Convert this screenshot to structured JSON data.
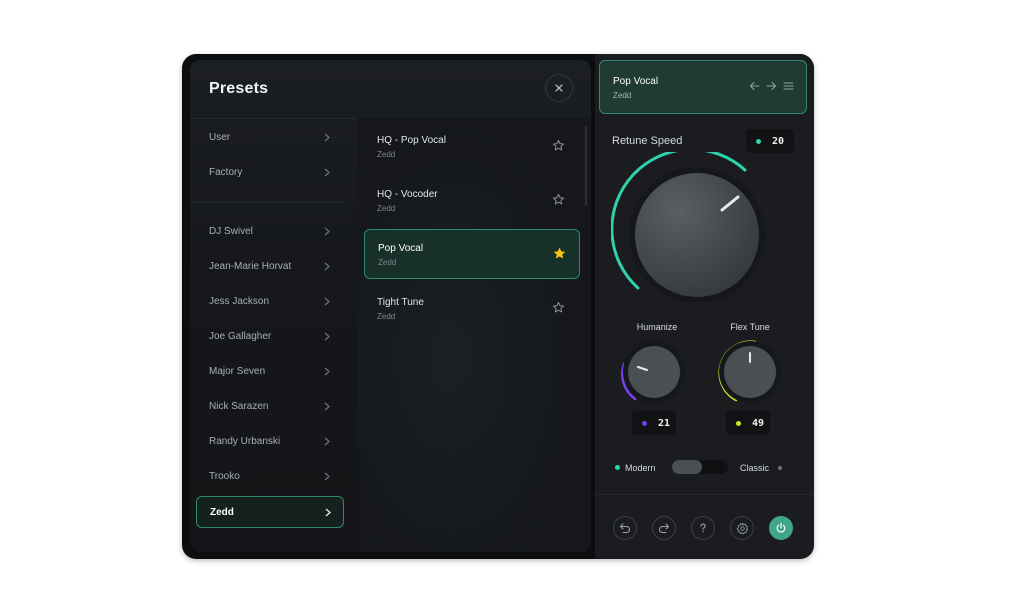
{
  "presets": {
    "title": "Presets",
    "categories": [
      {
        "label": "User"
      },
      {
        "label": "Factory"
      }
    ],
    "artists": [
      {
        "label": "DJ Swivel"
      },
      {
        "label": "Jean-Marie Horvat"
      },
      {
        "label": "Jess Jackson"
      },
      {
        "label": "Joe Gallagher"
      },
      {
        "label": "Major Seven"
      },
      {
        "label": "Nick Sarazen"
      },
      {
        "label": "Randy  Urbanski"
      },
      {
        "label": "Trooko"
      },
      {
        "label": "Zedd",
        "selected": true
      }
    ],
    "items": [
      {
        "name": "HQ - Pop Vocal",
        "author": "Zedd",
        "starred": false
      },
      {
        "name": "HQ - Vocoder",
        "author": "Zedd",
        "starred": false
      },
      {
        "name": "Pop Vocal",
        "author": "Zedd",
        "starred": true,
        "selected": true
      },
      {
        "name": "Tight Tune",
        "author": "Zedd",
        "starred": false
      }
    ]
  },
  "current_preset": {
    "name": "Pop Vocal",
    "author": "Zedd"
  },
  "retune_speed": {
    "label": "Retune Speed",
    "value": "20"
  },
  "humanize": {
    "label": "Humanize",
    "value": "21"
  },
  "flex_tune": {
    "label": "Flex Tune",
    "value": "49"
  },
  "mode": {
    "left": "Modern",
    "right": "Classic",
    "selected": "Modern"
  },
  "colors": {
    "accent_teal": "#2fd2ae",
    "accent_purple": "#7b3ff2",
    "accent_lime": "#d4e32a",
    "power": "#3fa58b",
    "star_active": "#f5c518"
  },
  "icons": {
    "close": "close-icon",
    "back": "arrow-left-icon",
    "forward": "arrow-right-icon",
    "menu": "menu-icon",
    "undo": "undo-icon",
    "redo": "redo-icon",
    "help": "help-icon",
    "settings": "gear-icon",
    "power": "power-icon"
  }
}
